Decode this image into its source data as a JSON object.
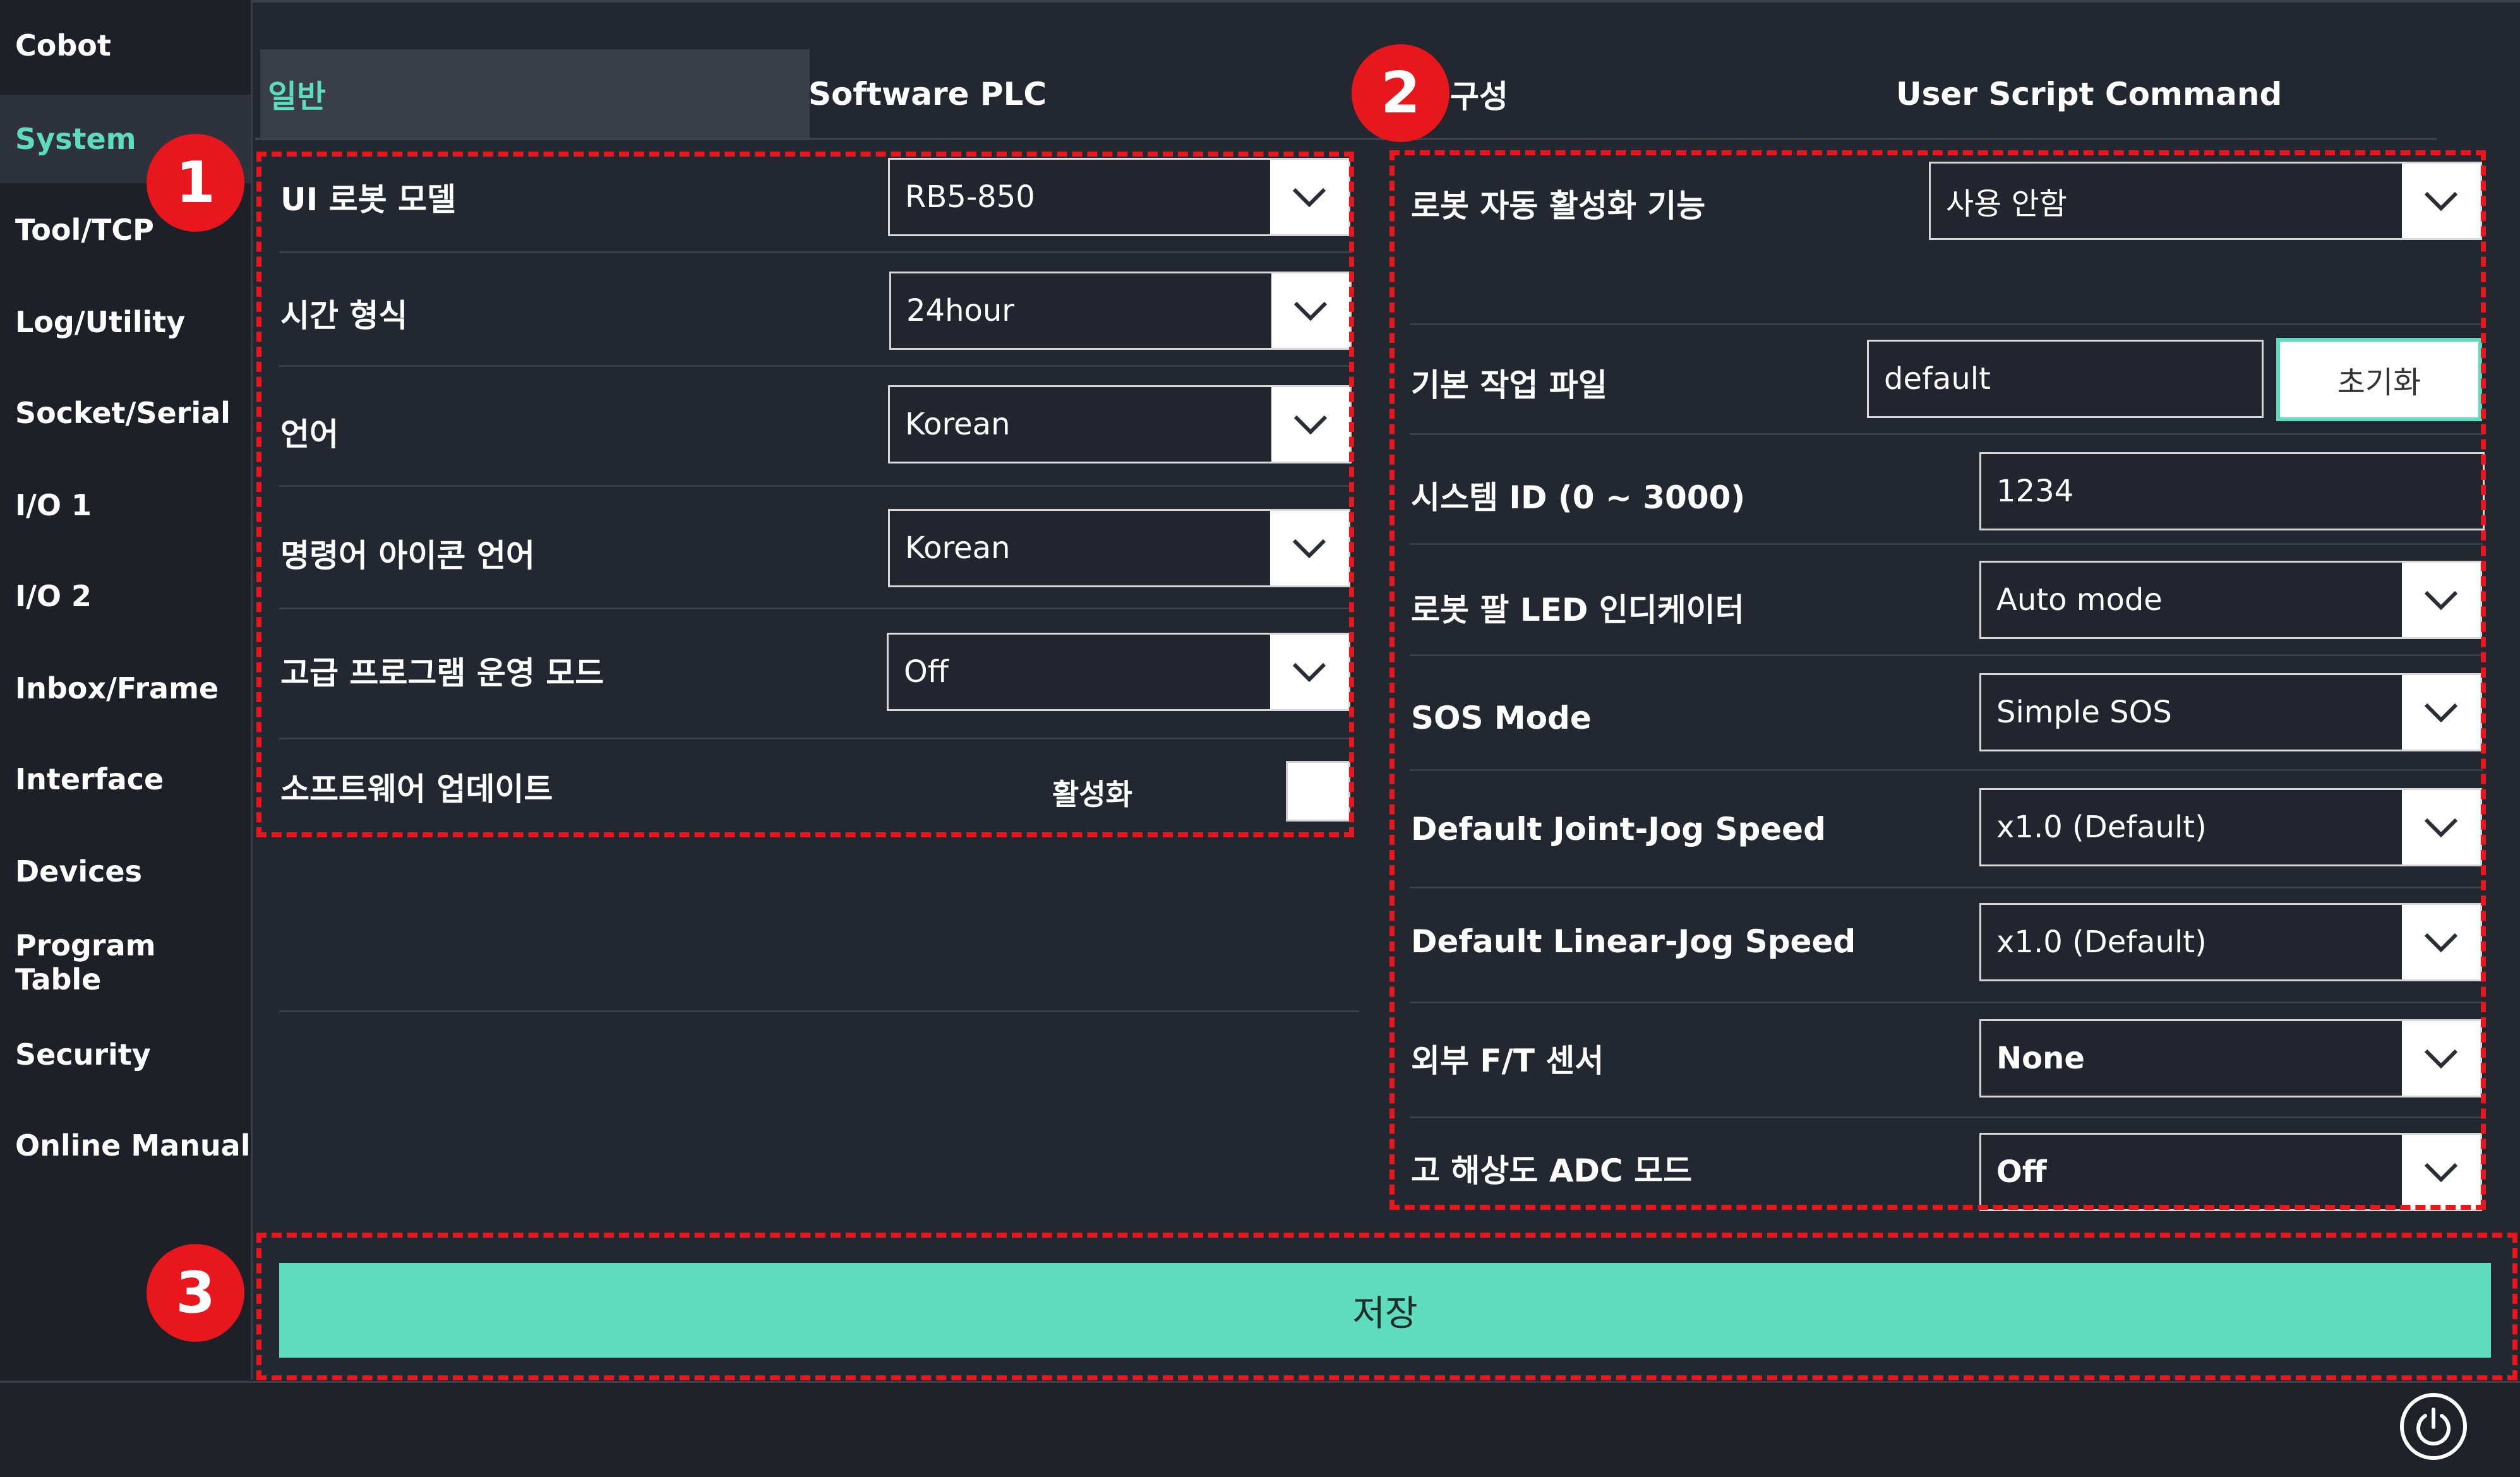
{
  "sidebar": {
    "items": [
      {
        "label": "Cobot"
      },
      {
        "label": "System"
      },
      {
        "label": "Tool/TCP"
      },
      {
        "label": "Log/Utility"
      },
      {
        "label": "Socket/Serial"
      },
      {
        "label": "I/O 1"
      },
      {
        "label": "I/O 2"
      },
      {
        "label": "Inbox/Frame"
      },
      {
        "label": "Interface"
      },
      {
        "label": "Devices"
      },
      {
        "label": "Program Table"
      },
      {
        "label": "Security"
      },
      {
        "label": "Online Manual"
      }
    ],
    "active_index": 1
  },
  "tabs": [
    {
      "label": "일반"
    },
    {
      "label": "Software PLC"
    },
    {
      "label": "구성"
    },
    {
      "label": "User Script Command"
    }
  ],
  "left_panel": {
    "ui_robot_model": {
      "label": "UI 로봇 모델",
      "value": "RB5-850"
    },
    "time_format": {
      "label": "시간 형식",
      "value": "24hour"
    },
    "language": {
      "label": "언어",
      "value": "Korean"
    },
    "command_icon_language": {
      "label": "명령어 아이콘 언어",
      "value": "Korean"
    },
    "advanced_program_mode": {
      "label": "고급 프로그램 운영 모드",
      "value": "Off"
    },
    "software_update": {
      "label": "소프트웨어 업데이트",
      "toggle_label": "활성화"
    }
  },
  "right_panel": {
    "robot_auto_activation": {
      "label": "로봇 자동 활성화 기능",
      "value": "사용 안함"
    },
    "default_work_file": {
      "label": "기본 작업 파일",
      "value": "default",
      "reset_label": "초기화"
    },
    "system_id": {
      "label": "시스템 ID (0 ~ 3000)",
      "value": "1234"
    },
    "arm_led_indicator": {
      "label": "로봇 팔 LED 인디케이터",
      "value": "Auto mode"
    },
    "sos_mode": {
      "label": "SOS Mode",
      "value": "Simple SOS"
    },
    "joint_jog_speed": {
      "label": "Default Joint-Jog Speed",
      "value": "x1.0 (Default)"
    },
    "linear_jog_speed": {
      "label": "Default Linear-Jog Speed",
      "value": "x1.0 (Default)"
    },
    "external_ft_sensor": {
      "label": "외부 F/T 센서",
      "value": "None"
    },
    "high_res_adc_mode": {
      "label": "고 해상도 ADC 모드",
      "value": "Off"
    }
  },
  "save_label": "저장",
  "annotations": [
    "1",
    "2",
    "3"
  ],
  "colors": {
    "accent": "#5fdcbd",
    "annotation": "#e8171e",
    "background": "#232730"
  },
  "icons": {
    "dropdown": "chevron-down-icon",
    "power": "power-icon"
  }
}
